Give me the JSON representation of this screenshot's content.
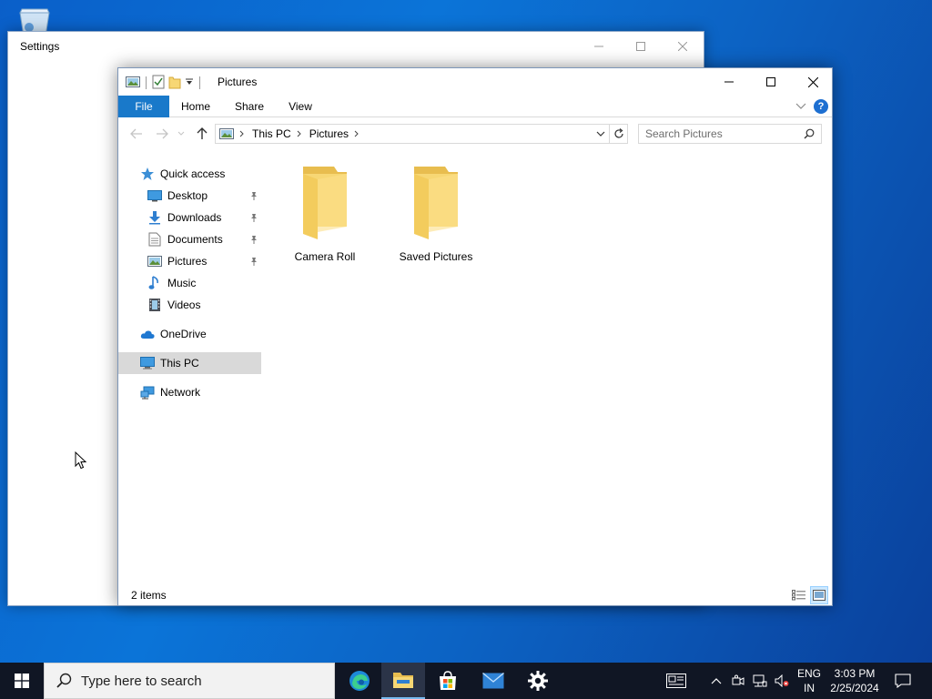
{
  "desktop": {
    "recycle_bin_icon": "recycle-bin-icon"
  },
  "settings_window": {
    "title": "Settings"
  },
  "explorer": {
    "title": "Pictures",
    "ribbon_tabs": [
      "File",
      "Home",
      "Share",
      "View"
    ],
    "breadcrumb": [
      "This PC",
      "Pictures"
    ],
    "search_placeholder": "Search Pictures",
    "nav_pane": {
      "quick_access": "Quick access",
      "pinned": [
        {
          "label": "Desktop",
          "icon": "desktop-folder-icon",
          "pinned": true
        },
        {
          "label": "Downloads",
          "icon": "downloads-icon",
          "pinned": true
        },
        {
          "label": "Documents",
          "icon": "documents-icon",
          "pinned": true
        },
        {
          "label": "Pictures",
          "icon": "pictures-icon",
          "pinned": true
        },
        {
          "label": "Music",
          "icon": "music-icon",
          "pinned": false
        },
        {
          "label": "Videos",
          "icon": "videos-icon",
          "pinned": false
        }
      ],
      "onedrive": "OneDrive",
      "this_pc": "This PC",
      "network": "Network",
      "selected": "This PC"
    },
    "items": [
      {
        "name": "Camera Roll",
        "icon": "folder-icon"
      },
      {
        "name": "Saved Pictures",
        "icon": "folder-icon"
      }
    ],
    "status": "2 items",
    "active_view": "large-icons"
  },
  "taskbar": {
    "search_placeholder": "Type here to search",
    "apps": [
      "edge-icon",
      "file-explorer-icon",
      "store-icon",
      "mail-icon",
      "settings-gear-icon"
    ],
    "active_app": "file-explorer-icon",
    "language_line1": "ENG",
    "language_line2": "IN",
    "time": "3:03 PM",
    "date": "2/25/2024"
  },
  "colors": {
    "accent": "#1979ca",
    "selection": "#d9d9d9",
    "folder": "#f7d774",
    "taskbar": "#101624"
  }
}
